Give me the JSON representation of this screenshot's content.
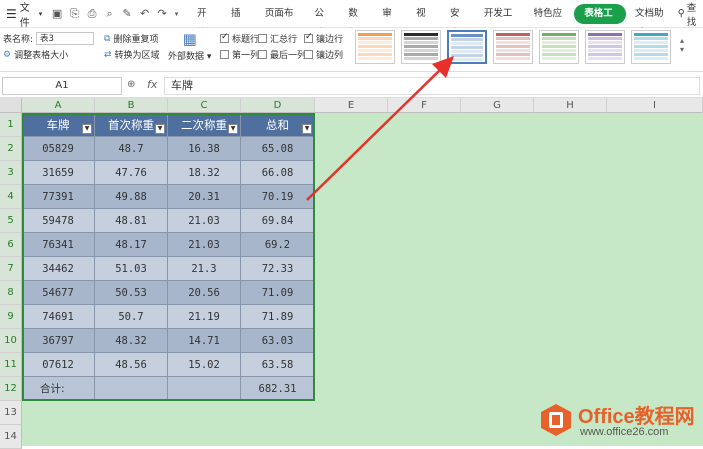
{
  "menubar": {
    "file_label": "文件",
    "tabs": [
      "开始",
      "插入",
      "页面布局",
      "公式",
      "数据",
      "审阅",
      "视图",
      "安全",
      "开发工具",
      "特色应用",
      "表格工具",
      "文档助手"
    ],
    "active_tab_index": 10,
    "search_label": "查找"
  },
  "ribbon": {
    "table_name_label": "表名称:",
    "table_name_value": "表3",
    "resize_label": "调整表格大小",
    "remove_dup_label": "删除重复项",
    "convert_label": "转换为区域",
    "external_data_label": "外部数据",
    "checkboxes": [
      {
        "label": "标题行",
        "checked": true
      },
      {
        "label": "汇总行",
        "checked": false
      },
      {
        "label": "镶边行",
        "checked": true
      },
      {
        "label": "第一列",
        "checked": false
      },
      {
        "label": "最后一列",
        "checked": false
      },
      {
        "label": "镶边列",
        "checked": false
      }
    ],
    "styles": [
      {
        "color": "#f0a050"
      },
      {
        "color": "#2b2b2b"
      },
      {
        "color": "#6a8fc0"
      },
      {
        "color": "#c06060"
      },
      {
        "color": "#70b060"
      },
      {
        "color": "#8a70b0"
      },
      {
        "color": "#40a8c0"
      }
    ],
    "selected_style_index": 2
  },
  "formula_bar": {
    "cell_ref": "A1",
    "fx_label": "fx",
    "content": "车牌"
  },
  "grid": {
    "columns": [
      "A",
      "B",
      "C",
      "D",
      "E",
      "F",
      "G",
      "H",
      "I"
    ],
    "rows": [
      "1",
      "2",
      "3",
      "4",
      "5",
      "6",
      "7",
      "8",
      "9",
      "10",
      "11",
      "12",
      "13",
      "14"
    ],
    "headers": [
      "车牌",
      "首次称重",
      "二次称重",
      "总和"
    ],
    "data": [
      [
        "05829",
        "48.7",
        "16.38",
        "65.08"
      ],
      [
        "31659",
        "47.76",
        "18.32",
        "66.08"
      ],
      [
        "77391",
        "49.88",
        "20.31",
        "70.19"
      ],
      [
        "59478",
        "48.81",
        "21.03",
        "69.84"
      ],
      [
        "76341",
        "48.17",
        "21.03",
        "69.2"
      ],
      [
        "34462",
        "51.03",
        "21.3",
        "72.33"
      ],
      [
        "54677",
        "50.53",
        "20.56",
        "71.09"
      ],
      [
        "74691",
        "50.7",
        "21.19",
        "71.89"
      ],
      [
        "36797",
        "48.32",
        "14.71",
        "63.03"
      ],
      [
        "07612",
        "48.56",
        "15.02",
        "63.58"
      ]
    ],
    "total_row": [
      "合计:",
      "",
      "",
      "682.31"
    ]
  },
  "watermark": {
    "brand": "Office教程网",
    "url": "www.office26.com"
  },
  "colors": {
    "accent": "#1aa04a",
    "table_header": "#4f6f9f",
    "arrow": "#e8302a"
  }
}
